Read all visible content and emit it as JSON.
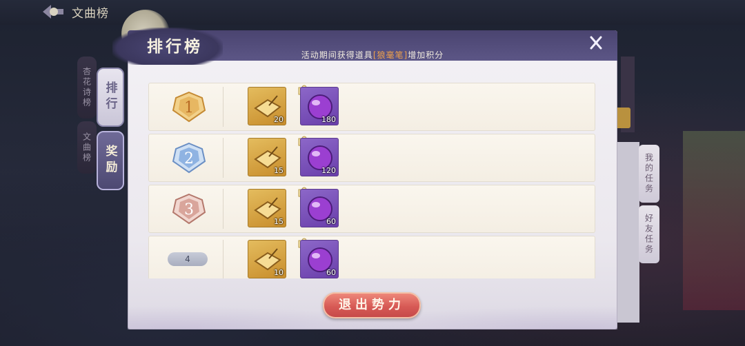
{
  "topbar": {
    "title": "文曲榜"
  },
  "side_tabs_bg": [
    {
      "label": "杏花诗榜"
    },
    {
      "label": "文曲榜"
    }
  ],
  "side_tabs": [
    {
      "label": "排行",
      "active": false
    },
    {
      "label": "奖励",
      "active": true
    }
  ],
  "bg_right_tabs": [
    {
      "label": "我的任务"
    },
    {
      "label": "好友任务"
    }
  ],
  "panel": {
    "title": "排行榜",
    "subtitle_before": "活动期间获得道具",
    "subtitle_item": "[狼毫笔]",
    "subtitle_after": "增加积分",
    "highlight_color": "#f0a24a"
  },
  "rewards": [
    {
      "rank": "1",
      "badge_color": "#d9a54a",
      "items": [
        {
          "icon": "gold-inkstone-icon",
          "count": "20"
        },
        {
          "icon": "purple-orb-icon",
          "count": "180"
        }
      ]
    },
    {
      "rank": "2",
      "badge_color": "#7ea6d8",
      "items": [
        {
          "icon": "gold-inkstone-icon",
          "count": "15"
        },
        {
          "icon": "purple-orb-icon",
          "count": "120"
        }
      ]
    },
    {
      "rank": "3",
      "badge_color": "#d6a29a",
      "items": [
        {
          "icon": "gold-inkstone-icon",
          "count": "15"
        },
        {
          "icon": "purple-orb-icon",
          "count": "60"
        }
      ]
    },
    {
      "rank": "4",
      "badge_color": "#b4b8c6",
      "items": [
        {
          "icon": "gold-inkstone-icon",
          "count": "10"
        },
        {
          "icon": "purple-orb-icon",
          "count": "60"
        }
      ]
    }
  ],
  "exit_button": {
    "label": "退出势力"
  }
}
